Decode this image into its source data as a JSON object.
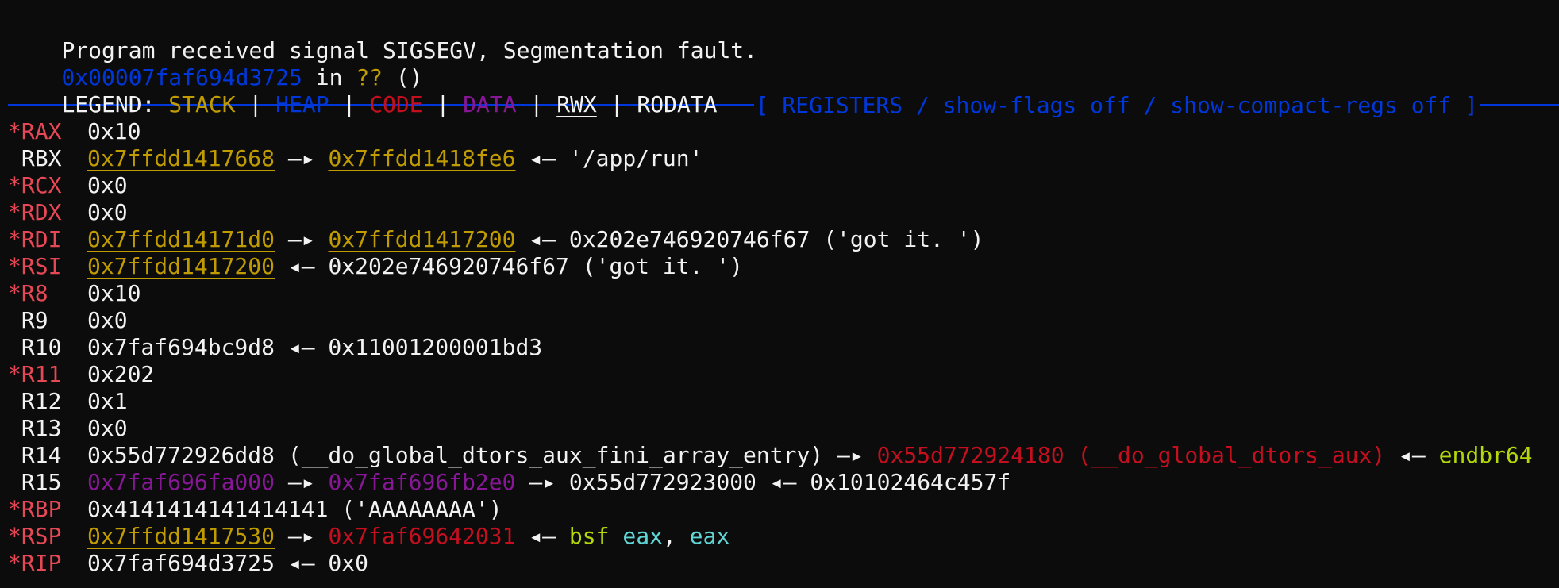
{
  "header": {
    "signal_line": "Program received signal SIGSEGV, Segmentation fault.",
    "pc_addr": "0x00007faf694d3725",
    "pc_in": " in ",
    "pc_sym": "??",
    "pc_paren": " ()",
    "legend_label": "LEGEND: ",
    "legend_stack": "STACK",
    "legend_heap": "HEAP",
    "legend_code": "CODE",
    "legend_data": "DATA",
    "legend_rwx": "RWX",
    "legend_rodata": "RODATA",
    "sep": " | "
  },
  "banner": {
    "title": "[ REGISTERS / show-flags off / show-compact-regs off ]"
  },
  "registers": [
    {
      "name": "*RAX",
      "modified": true,
      "parts": [
        {
          "text": "0x10",
          "cls": "white"
        }
      ]
    },
    {
      "name": " RBX",
      "modified": false,
      "parts": [
        {
          "text": "0x7ffdd1417668",
          "cls": "stack u"
        },
        {
          "text": " —▸ ",
          "cls": "white"
        },
        {
          "text": "0x7ffdd1418fe6",
          "cls": "stack u"
        },
        {
          "text": " ◂— '/app/run'",
          "cls": "white"
        }
      ]
    },
    {
      "name": "*RCX",
      "modified": true,
      "parts": [
        {
          "text": "0x0",
          "cls": "white"
        }
      ]
    },
    {
      "name": "*RDX",
      "modified": true,
      "parts": [
        {
          "text": "0x0",
          "cls": "white"
        }
      ]
    },
    {
      "name": "*RDI",
      "modified": true,
      "parts": [
        {
          "text": "0x7ffdd14171d0",
          "cls": "stack u"
        },
        {
          "text": " —▸ ",
          "cls": "white"
        },
        {
          "text": "0x7ffdd1417200",
          "cls": "stack u"
        },
        {
          "text": " ◂— 0x202e746920746f67 ('got it. ')",
          "cls": "white"
        }
      ]
    },
    {
      "name": "*RSI",
      "modified": true,
      "parts": [
        {
          "text": "0x7ffdd1417200",
          "cls": "stack u"
        },
        {
          "text": " ◂— 0x202e746920746f67 ('got it. ')",
          "cls": "white"
        }
      ]
    },
    {
      "name": "*R8",
      "modified": true,
      "parts": [
        {
          "text": "0x10",
          "cls": "white"
        }
      ]
    },
    {
      "name": " R9",
      "modified": false,
      "parts": [
        {
          "text": "0x0",
          "cls": "white"
        }
      ]
    },
    {
      "name": " R10",
      "modified": false,
      "parts": [
        {
          "text": "0x7faf694bc9d8 ◂— 0x11001200001bd3",
          "cls": "white"
        }
      ]
    },
    {
      "name": "*R11",
      "modified": true,
      "parts": [
        {
          "text": "0x202",
          "cls": "white"
        }
      ]
    },
    {
      "name": " R12",
      "modified": false,
      "parts": [
        {
          "text": "0x1",
          "cls": "white"
        }
      ]
    },
    {
      "name": " R13",
      "modified": false,
      "parts": [
        {
          "text": "0x0",
          "cls": "white"
        }
      ]
    },
    {
      "name": " R14",
      "modified": false,
      "parts": [
        {
          "text": "0x55d772926dd8 (__do_global_dtors_aux_fini_array_entry) —▸ ",
          "cls": "white"
        },
        {
          "text": "0x55d772924180 (__do_global_dtors_aux)",
          "cls": "code"
        },
        {
          "text": " ◂— ",
          "cls": "white"
        },
        {
          "text": "endbr64",
          "cls": "green"
        }
      ]
    },
    {
      "name": " R15",
      "modified": false,
      "parts": [
        {
          "text": "0x7faf696fa000",
          "cls": "data"
        },
        {
          "text": " —▸ ",
          "cls": "white"
        },
        {
          "text": "0x7faf696fb2e0",
          "cls": "data"
        },
        {
          "text": " —▸ 0x55d772923000 ◂— 0x10102464c457f",
          "cls": "white"
        }
      ]
    },
    {
      "name": "*RBP",
      "modified": true,
      "parts": [
        {
          "text": "0x4141414141414141 ('AAAAAAAA')",
          "cls": "white"
        }
      ]
    },
    {
      "name": "*RSP",
      "modified": true,
      "parts": [
        {
          "text": "0x7ffdd1417530",
          "cls": "stack u"
        },
        {
          "text": " —▸ ",
          "cls": "white"
        },
        {
          "text": "0x7faf69642031",
          "cls": "code"
        },
        {
          "text": " ◂— ",
          "cls": "white"
        },
        {
          "text": "bsf",
          "cls": "green"
        },
        {
          "text": " ",
          "cls": "white"
        },
        {
          "text": "eax",
          "cls": "cyan"
        },
        {
          "text": ", ",
          "cls": "white"
        },
        {
          "text": "eax",
          "cls": "cyan"
        }
      ]
    },
    {
      "name": "*RIP",
      "modified": true,
      "parts": [
        {
          "text": "0x7faf694d3725 ◂— 0x0",
          "cls": "white"
        }
      ]
    }
  ]
}
